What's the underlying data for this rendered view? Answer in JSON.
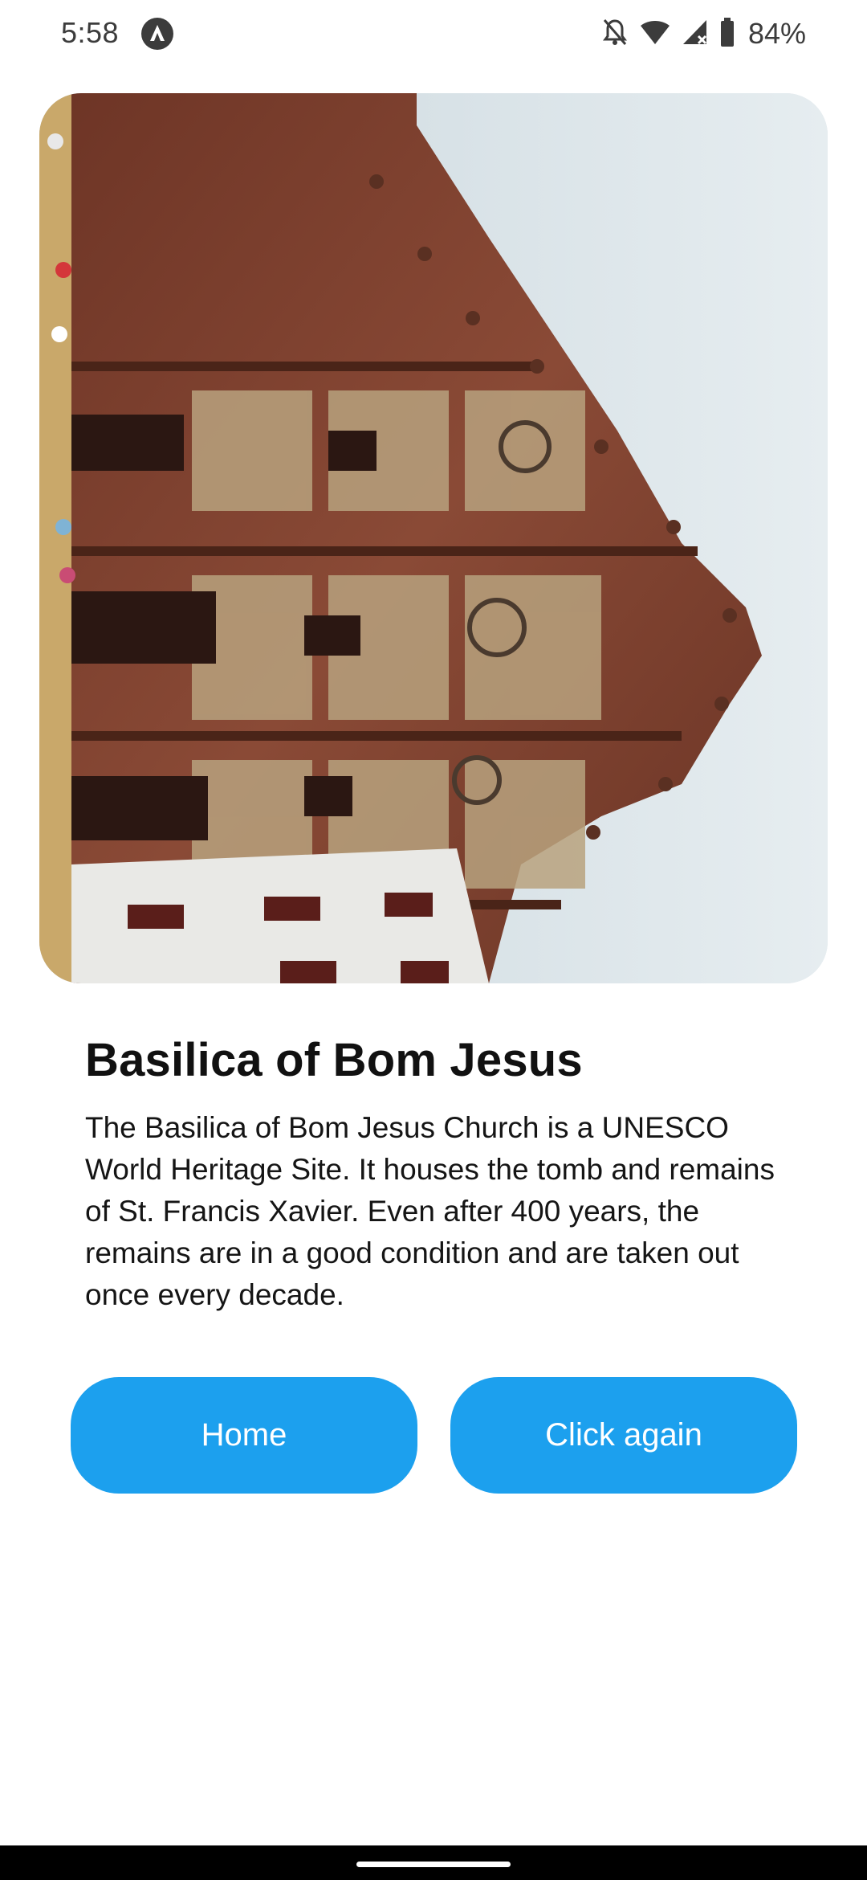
{
  "status_bar": {
    "time": "5:58",
    "battery_percent": "84%",
    "icons": [
      "app-notification-icon",
      "bell-off-icon",
      "wifi-icon",
      "cellular-signal-icon",
      "battery-icon"
    ]
  },
  "hero": {
    "image_description": "Basilica of Bom Jesus facade photograph"
  },
  "content": {
    "title": "Basilica of Bom Jesus",
    "description": "The Basilica of Bom Jesus Church is a UNESCO World Heritage Site. It houses the tomb and remains of St. Francis Xavier. Even after 400 years, the remains are in a good condition and are taken out once every decade."
  },
  "buttons": {
    "home_label": "Home",
    "click_again_label": "Click again"
  },
  "colors": {
    "accent": "#1ca0ee",
    "background": "#ffffff",
    "text": "#111111"
  }
}
